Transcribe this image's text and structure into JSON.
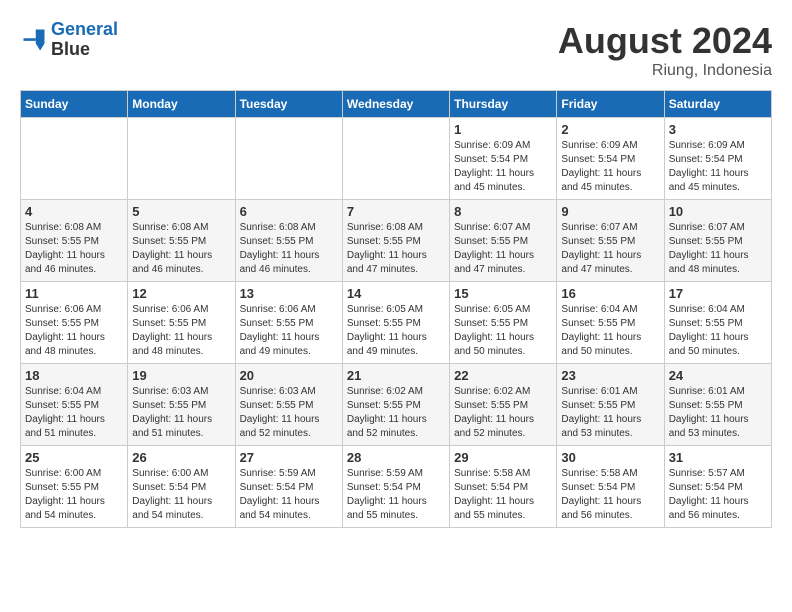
{
  "header": {
    "logo_line1": "General",
    "logo_line2": "Blue",
    "month_year": "August 2024",
    "location": "Riung, Indonesia"
  },
  "weekdays": [
    "Sunday",
    "Monday",
    "Tuesday",
    "Wednesday",
    "Thursday",
    "Friday",
    "Saturday"
  ],
  "weeks": [
    [
      {
        "day": "",
        "sunrise": "",
        "sunset": "",
        "daylight": ""
      },
      {
        "day": "",
        "sunrise": "",
        "sunset": "",
        "daylight": ""
      },
      {
        "day": "",
        "sunrise": "",
        "sunset": "",
        "daylight": ""
      },
      {
        "day": "",
        "sunrise": "",
        "sunset": "",
        "daylight": ""
      },
      {
        "day": "1",
        "sunrise": "Sunrise: 6:09 AM",
        "sunset": "Sunset: 5:54 PM",
        "daylight": "Daylight: 11 hours and 45 minutes."
      },
      {
        "day": "2",
        "sunrise": "Sunrise: 6:09 AM",
        "sunset": "Sunset: 5:54 PM",
        "daylight": "Daylight: 11 hours and 45 minutes."
      },
      {
        "day": "3",
        "sunrise": "Sunrise: 6:09 AM",
        "sunset": "Sunset: 5:54 PM",
        "daylight": "Daylight: 11 hours and 45 minutes."
      }
    ],
    [
      {
        "day": "4",
        "sunrise": "Sunrise: 6:08 AM",
        "sunset": "Sunset: 5:55 PM",
        "daylight": "Daylight: 11 hours and 46 minutes."
      },
      {
        "day": "5",
        "sunrise": "Sunrise: 6:08 AM",
        "sunset": "Sunset: 5:55 PM",
        "daylight": "Daylight: 11 hours and 46 minutes."
      },
      {
        "day": "6",
        "sunrise": "Sunrise: 6:08 AM",
        "sunset": "Sunset: 5:55 PM",
        "daylight": "Daylight: 11 hours and 46 minutes."
      },
      {
        "day": "7",
        "sunrise": "Sunrise: 6:08 AM",
        "sunset": "Sunset: 5:55 PM",
        "daylight": "Daylight: 11 hours and 47 minutes."
      },
      {
        "day": "8",
        "sunrise": "Sunrise: 6:07 AM",
        "sunset": "Sunset: 5:55 PM",
        "daylight": "Daylight: 11 hours and 47 minutes."
      },
      {
        "day": "9",
        "sunrise": "Sunrise: 6:07 AM",
        "sunset": "Sunset: 5:55 PM",
        "daylight": "Daylight: 11 hours and 47 minutes."
      },
      {
        "day": "10",
        "sunrise": "Sunrise: 6:07 AM",
        "sunset": "Sunset: 5:55 PM",
        "daylight": "Daylight: 11 hours and 48 minutes."
      }
    ],
    [
      {
        "day": "11",
        "sunrise": "Sunrise: 6:06 AM",
        "sunset": "Sunset: 5:55 PM",
        "daylight": "Daylight: 11 hours and 48 minutes."
      },
      {
        "day": "12",
        "sunrise": "Sunrise: 6:06 AM",
        "sunset": "Sunset: 5:55 PM",
        "daylight": "Daylight: 11 hours and 48 minutes."
      },
      {
        "day": "13",
        "sunrise": "Sunrise: 6:06 AM",
        "sunset": "Sunset: 5:55 PM",
        "daylight": "Daylight: 11 hours and 49 minutes."
      },
      {
        "day": "14",
        "sunrise": "Sunrise: 6:05 AM",
        "sunset": "Sunset: 5:55 PM",
        "daylight": "Daylight: 11 hours and 49 minutes."
      },
      {
        "day": "15",
        "sunrise": "Sunrise: 6:05 AM",
        "sunset": "Sunset: 5:55 PM",
        "daylight": "Daylight: 11 hours and 50 minutes."
      },
      {
        "day": "16",
        "sunrise": "Sunrise: 6:04 AM",
        "sunset": "Sunset: 5:55 PM",
        "daylight": "Daylight: 11 hours and 50 minutes."
      },
      {
        "day": "17",
        "sunrise": "Sunrise: 6:04 AM",
        "sunset": "Sunset: 5:55 PM",
        "daylight": "Daylight: 11 hours and 50 minutes."
      }
    ],
    [
      {
        "day": "18",
        "sunrise": "Sunrise: 6:04 AM",
        "sunset": "Sunset: 5:55 PM",
        "daylight": "Daylight: 11 hours and 51 minutes."
      },
      {
        "day": "19",
        "sunrise": "Sunrise: 6:03 AM",
        "sunset": "Sunset: 5:55 PM",
        "daylight": "Daylight: 11 hours and 51 minutes."
      },
      {
        "day": "20",
        "sunrise": "Sunrise: 6:03 AM",
        "sunset": "Sunset: 5:55 PM",
        "daylight": "Daylight: 11 hours and 52 minutes."
      },
      {
        "day": "21",
        "sunrise": "Sunrise: 6:02 AM",
        "sunset": "Sunset: 5:55 PM",
        "daylight": "Daylight: 11 hours and 52 minutes."
      },
      {
        "day": "22",
        "sunrise": "Sunrise: 6:02 AM",
        "sunset": "Sunset: 5:55 PM",
        "daylight": "Daylight: 11 hours and 52 minutes."
      },
      {
        "day": "23",
        "sunrise": "Sunrise: 6:01 AM",
        "sunset": "Sunset: 5:55 PM",
        "daylight": "Daylight: 11 hours and 53 minutes."
      },
      {
        "day": "24",
        "sunrise": "Sunrise: 6:01 AM",
        "sunset": "Sunset: 5:55 PM",
        "daylight": "Daylight: 11 hours and 53 minutes."
      }
    ],
    [
      {
        "day": "25",
        "sunrise": "Sunrise: 6:00 AM",
        "sunset": "Sunset: 5:55 PM",
        "daylight": "Daylight: 11 hours and 54 minutes."
      },
      {
        "day": "26",
        "sunrise": "Sunrise: 6:00 AM",
        "sunset": "Sunset: 5:54 PM",
        "daylight": "Daylight: 11 hours and 54 minutes."
      },
      {
        "day": "27",
        "sunrise": "Sunrise: 5:59 AM",
        "sunset": "Sunset: 5:54 PM",
        "daylight": "Daylight: 11 hours and 54 minutes."
      },
      {
        "day": "28",
        "sunrise": "Sunrise: 5:59 AM",
        "sunset": "Sunset: 5:54 PM",
        "daylight": "Daylight: 11 hours and 55 minutes."
      },
      {
        "day": "29",
        "sunrise": "Sunrise: 5:58 AM",
        "sunset": "Sunset: 5:54 PM",
        "daylight": "Daylight: 11 hours and 55 minutes."
      },
      {
        "day": "30",
        "sunrise": "Sunrise: 5:58 AM",
        "sunset": "Sunset: 5:54 PM",
        "daylight": "Daylight: 11 hours and 56 minutes."
      },
      {
        "day": "31",
        "sunrise": "Sunrise: 5:57 AM",
        "sunset": "Sunset: 5:54 PM",
        "daylight": "Daylight: 11 hours and 56 minutes."
      }
    ]
  ]
}
